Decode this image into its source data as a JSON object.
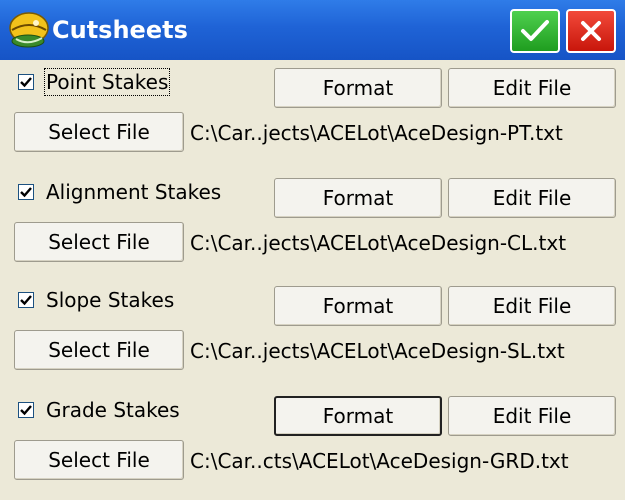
{
  "window": {
    "title": "Cutsheets",
    "logo_icon": "surveyor-helmet-icon",
    "ok_icon": "checkmark-icon",
    "close_icon": "close-icon",
    "ok_color": "#22a822",
    "close_color": "#d81e10"
  },
  "sections": [
    {
      "checkbox_label": "Point Stakes",
      "checked": true,
      "format_label": "Format",
      "edit_label": "Edit File",
      "select_label": "Select File",
      "path": "C:\\Car..jects\\ACELot\\AceDesign-PT.txt"
    },
    {
      "checkbox_label": "Alignment Stakes",
      "checked": true,
      "format_label": "Format",
      "edit_label": "Edit File",
      "select_label": "Select File",
      "path": "C:\\Car..jects\\ACELot\\AceDesign-CL.txt"
    },
    {
      "checkbox_label": "Slope Stakes",
      "checked": true,
      "format_label": "Format",
      "edit_label": "Edit File",
      "select_label": "Select File",
      "path": "C:\\Car..jects\\ACELot\\AceDesign-SL.txt"
    },
    {
      "checkbox_label": "Grade Stakes",
      "checked": true,
      "format_label": "Format",
      "edit_label": "Edit File",
      "select_label": "Select File",
      "path": "C:\\Car..cts\\ACELot\\AceDesign-GRD.txt"
    }
  ]
}
